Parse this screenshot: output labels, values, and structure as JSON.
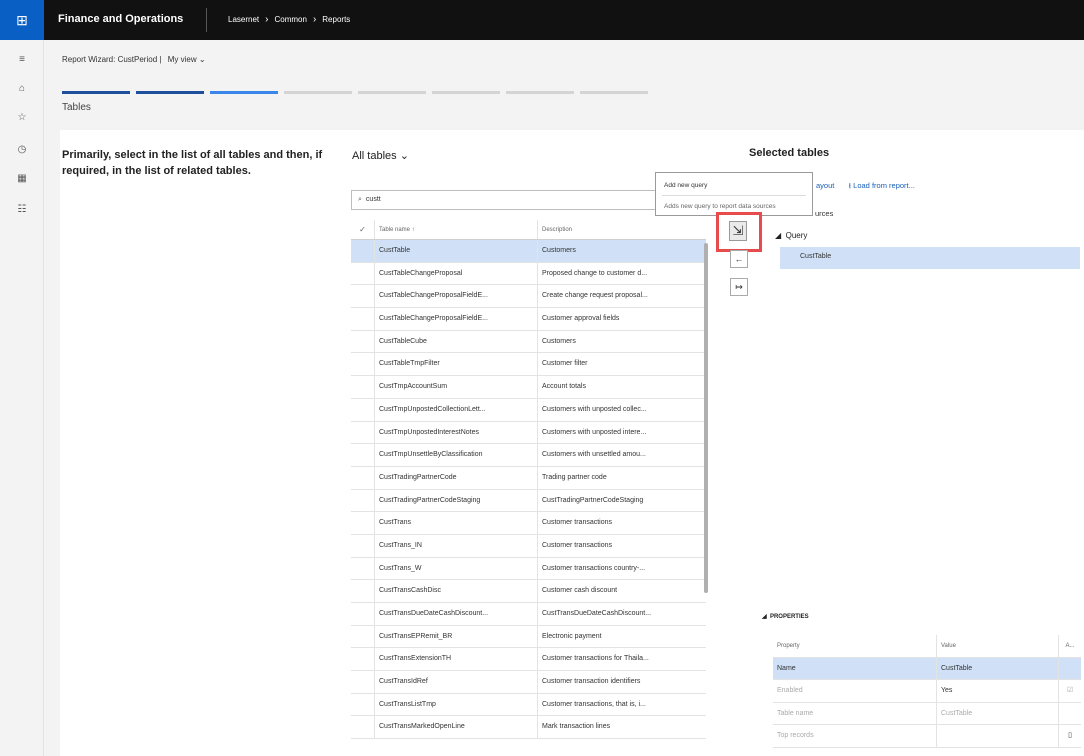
{
  "topbar": {
    "waffle_icon": "waffle-icon",
    "app_title": "Finance and Operations",
    "breadcrumb": [
      "Lasernet",
      "Common",
      "Reports"
    ]
  },
  "leftrail": {
    "icons": [
      "menu-icon",
      "home-icon",
      "star-icon",
      "clock-icon",
      "grid-icon",
      "list-icon"
    ]
  },
  "header": {
    "form_title": "Report Wizard: CustPeriod",
    "separator": "|",
    "view": "My view",
    "section_title": "Tables"
  },
  "instruction": "Primarily, select in the list of all tables and then, if required, in the list of related tables.",
  "all_tables": {
    "title": "All tables",
    "search_value": "custt",
    "columns": [
      "Table name",
      "Description"
    ],
    "sort_indicator": "↑",
    "rows": [
      [
        "CustTable",
        "Customers"
      ],
      [
        "CustTableChangeProposal",
        "Proposed change to customer d..."
      ],
      [
        "CustTableChangeProposalFieldE...",
        "Create change request proposal..."
      ],
      [
        "CustTableChangeProposalFieldE...",
        "Customer approval fields"
      ],
      [
        "CustTableCube",
        "Customers"
      ],
      [
        "CustTableTmpFilter",
        "Customer filter"
      ],
      [
        "CustTmpAccountSum",
        "Account totals"
      ],
      [
        "CustTmpUnpostedCollectionLett...",
        "Customers with unposted collec..."
      ],
      [
        "CustTmpUnpostedInterestNotes",
        "Customers with unposted intere..."
      ],
      [
        "CustTmpUnsettleByClassification",
        "Customers with unsettled amou..."
      ],
      [
        "CustTradingPartnerCode",
        "Trading partner code"
      ],
      [
        "CustTradingPartnerCodeStaging",
        "CustTradingPartnerCodeStaging"
      ],
      [
        "CustTrans",
        "Customer transactions"
      ],
      [
        "CustTrans_IN",
        "Customer transactions"
      ],
      [
        "CustTrans_W",
        "Customer transactions country-..."
      ],
      [
        "CustTransCashDisc",
        "Customer cash discount"
      ],
      [
        "CustTransDueDateCashDiscount...",
        "CustTransDueDateCashDiscount..."
      ],
      [
        "CustTransEPRemit_BR",
        "Electronic payment"
      ],
      [
        "CustTransExtensionTH",
        "Customer transactions for Thaila..."
      ],
      [
        "CustTransIdRef",
        "Customer transaction identifiers"
      ],
      [
        "CustTransListTmp",
        "Customer transactions, that is, i..."
      ],
      [
        "CustTransMarkedOpenLine",
        "Mark transaction lines"
      ]
    ]
  },
  "tooltip": {
    "title": "Add new query",
    "description": "Adds new query to report data sources"
  },
  "selected_tables": {
    "title": "Selected tables",
    "action_layout": "ayout",
    "action_load": "Load from report...",
    "sources_label": "urces",
    "tree_query": "Query",
    "tree_item": "CustTable"
  },
  "properties": {
    "title": "PROPERTIES",
    "columns": [
      "Property",
      "Value",
      "A..."
    ],
    "rows": [
      {
        "property": "Name",
        "value": "CustTable",
        "extra": ""
      },
      {
        "property": "Enabled",
        "value": "Yes",
        "extra": "☑"
      },
      {
        "property": "Table name",
        "value": "CustTable",
        "extra": ""
      },
      {
        "property": "Top records",
        "value": "",
        "extra": "▯"
      }
    ]
  },
  "colors": {
    "topbar": "#111111",
    "waffle": "#0a5fc4",
    "highlight": "#e84b4b",
    "selection": "#cfe0f7",
    "link": "#1a5eb5"
  }
}
